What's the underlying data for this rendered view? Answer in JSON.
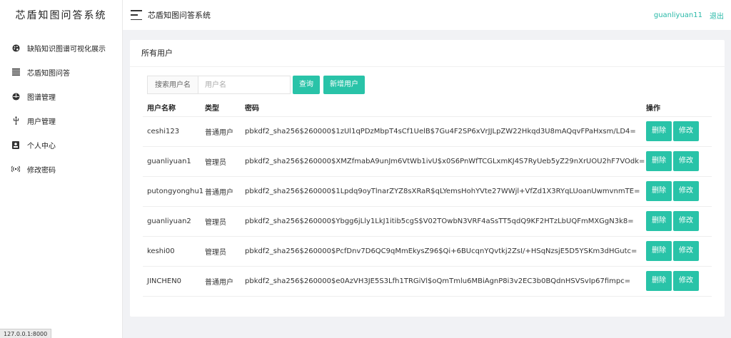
{
  "app": {
    "logo_text": "芯盾知图问答系统"
  },
  "sidebar": {
    "items": [
      {
        "label": "缺陷知识图谱可视化展示",
        "icon": "palette-icon"
      },
      {
        "label": "芯盾知图问答",
        "icon": "list-icon"
      },
      {
        "label": "图谱管理",
        "icon": "dashboard-icon"
      },
      {
        "label": "用户管理",
        "icon": "usb-icon"
      },
      {
        "label": "个人中心",
        "icon": "id-card-icon"
      },
      {
        "label": "修改密码",
        "icon": "signal-icon"
      }
    ]
  },
  "header": {
    "title": "芯盾知图问答系统",
    "username": "guanliyuan11",
    "logout_label": "退出"
  },
  "main": {
    "card_title": "所有用户",
    "search": {
      "label": "搜索用户名",
      "placeholder": "用户名",
      "value": "",
      "query_button": "查询",
      "add_button": "新增用户"
    },
    "columns": {
      "name": "用户名称",
      "type": "类型",
      "password": "密码",
      "ops": "操作"
    },
    "rows": [
      {
        "name": "ceshi123",
        "type": "普通用户",
        "password": "pbkdf2_sha256$260000$1zUl1qPDzMbpT4sCf1UelB$7Gu4F2SP6xVrJJLpZW22Hkqd3U8mAQqvFPaHxsm/LD4="
      },
      {
        "name": "guanliyuan1",
        "type": "管理员",
        "password": "pbkdf2_sha256$260000$XMZfmabA9unJm6VtWb1ivU$x0S6PnWfTCGLxmKJ4S7RyUeb5yZ29nXrUOU2hF7VOdk="
      },
      {
        "name": "putongyonghu1",
        "type": "普通用户",
        "password": "pbkdf2_sha256$260000$1Lpdq9oyTlnarZYZ8sXRaR$qLYemsHohYVte27WWjl+VfZd1X3RYqLUoanUwmvnmTE="
      },
      {
        "name": "guanliyuan2",
        "type": "管理员",
        "password": "pbkdf2_sha256$260000$Ybgg6jLly1LkJ1itib5cgS$V02TOwbN3VRF4aSsTT5qdQ9KF2HTzLbUQFmMXGgN3k8="
      },
      {
        "name": "keshi00",
        "type": "管理员",
        "password": "pbkdf2_sha256$260000$PcfDnv7D6QC9qMmEkysZ96$Qi+6BUcqnYQvtkj2ZsI/+HSqNzsjE5D5YSKm3dHGutc="
      },
      {
        "name": "JINCHEN0",
        "type": "普通用户",
        "password": "pbkdf2_sha256$260000$e0AzVH3JE5S3Lfh1TRGiVl$oQmTmlu6MBiAgnP8i3v2EC3b0BQdnHSVSvIp67fimpc="
      }
    ],
    "delete_label": "删除",
    "edit_label": "修改"
  },
  "statusbar": {
    "url": "127.0.0.1:8000"
  },
  "colors": {
    "accent": "#29c3a8",
    "link": "#29b9a8"
  }
}
